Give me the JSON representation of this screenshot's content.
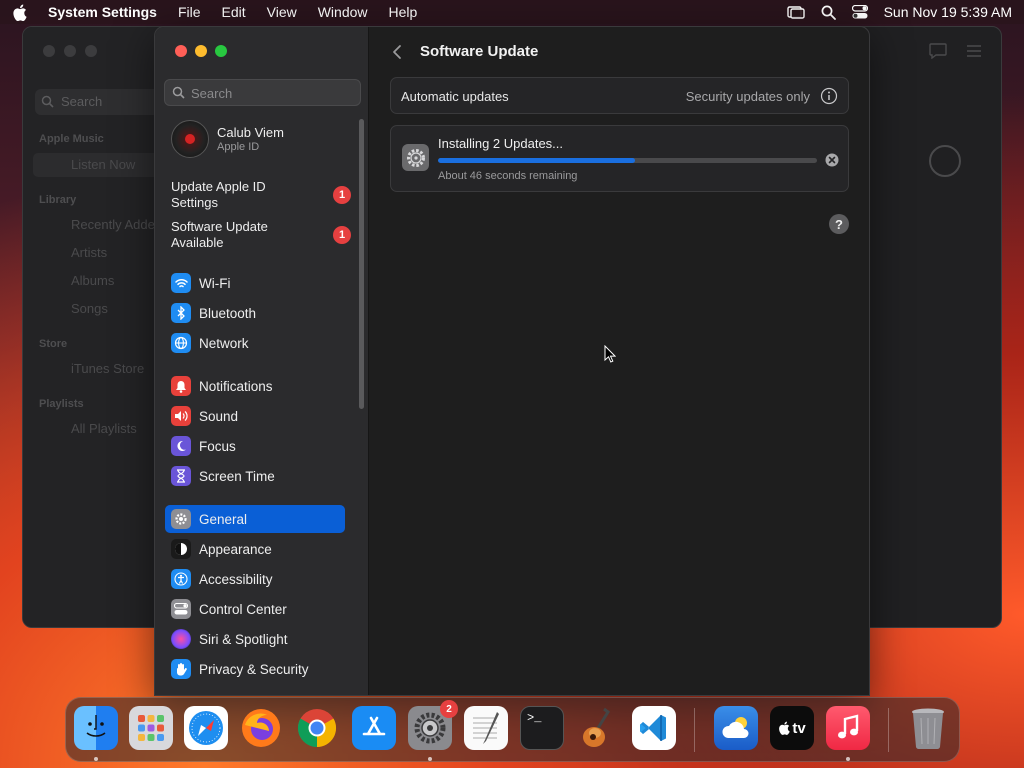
{
  "menubar": {
    "app_name": "System Settings",
    "items": [
      "File",
      "Edit",
      "View",
      "Window",
      "Help"
    ],
    "datetime": "Sun Nov 19  5:39 AM"
  },
  "music_window": {
    "search_placeholder": "Search",
    "sections": [
      {
        "title": "Apple Music",
        "items": [
          "Listen Now"
        ]
      },
      {
        "title": "Library",
        "items": [
          "Recently Added",
          "Artists",
          "Albums",
          "Songs"
        ]
      },
      {
        "title": "Store",
        "items": [
          "iTunes Store"
        ]
      },
      {
        "title": "Playlists",
        "items": [
          "All Playlists"
        ]
      }
    ]
  },
  "sidebar": {
    "search_placeholder": "Search",
    "user": {
      "name": "Calub Viem",
      "subtitle": "Apple ID"
    },
    "alerts": [
      {
        "label": "Update Apple ID Settings",
        "count": "1"
      },
      {
        "label": "Software Update Available",
        "count": "1"
      }
    ],
    "items": [
      {
        "label": "Wi-Fi",
        "icon": "wifi-icon",
        "color": "#1f8cf2"
      },
      {
        "label": "Bluetooth",
        "icon": "bluetooth-icon",
        "color": "#1f8cf2"
      },
      {
        "label": "Network",
        "icon": "globe-icon",
        "color": "#1f8cf2"
      },
      {
        "label": "Notifications",
        "icon": "bell-icon",
        "color": "#e8413b"
      },
      {
        "label": "Sound",
        "icon": "speaker-icon",
        "color": "#e8413b"
      },
      {
        "label": "Focus",
        "icon": "moon-icon",
        "color": "#6a55d8"
      },
      {
        "label": "Screen Time",
        "icon": "hourglass-icon",
        "color": "#6a55d8"
      },
      {
        "label": "General",
        "icon": "gear-icon",
        "color": "#8e8e93",
        "selected": true
      },
      {
        "label": "Appearance",
        "icon": "appearance-icon",
        "color": "#1a1a1a"
      },
      {
        "label": "Accessibility",
        "icon": "accessibility-icon",
        "color": "#1f8cf2"
      },
      {
        "label": "Control Center",
        "icon": "control-center-icon",
        "color": "#8e8e93"
      },
      {
        "label": "Siri & Spotlight",
        "icon": "siri-icon",
        "color": "#b14fd8"
      },
      {
        "label": "Privacy & Security",
        "icon": "hand-icon",
        "color": "#1f8cf2"
      }
    ]
  },
  "content": {
    "title": "Software Update",
    "auto_updates_label": "Automatic updates",
    "auto_updates_value": "Security updates only",
    "install_title": "Installing 2 Updates...",
    "install_progress": 0.52,
    "install_remaining": "About 46 seconds remaining",
    "help_label": "?"
  },
  "dock": {
    "apps": [
      {
        "name": "Finder",
        "icon": "finder-icon",
        "running": true
      },
      {
        "name": "Launchpad",
        "icon": "launchpad-icon",
        "running": false
      },
      {
        "name": "Safari",
        "icon": "safari-icon",
        "running": false
      },
      {
        "name": "Firefox",
        "icon": "firefox-icon",
        "running": false
      },
      {
        "name": "Chrome",
        "icon": "chrome-icon",
        "running": false
      },
      {
        "name": "App Store",
        "icon": "app-store-icon",
        "running": false
      },
      {
        "name": "System Settings",
        "icon": "settings-icon",
        "running": true,
        "badge": "2"
      },
      {
        "name": "TextEdit",
        "icon": "textedit-icon",
        "running": false
      },
      {
        "name": "Terminal",
        "icon": "terminal-icon",
        "running": false
      },
      {
        "name": "GarageBand",
        "icon": "garageband-icon",
        "running": false
      },
      {
        "name": "VS Code",
        "icon": "vscode-icon",
        "running": false
      },
      {
        "name": "Weather",
        "icon": "weather-icon",
        "running": false
      },
      {
        "name": "Apple TV",
        "icon": "appletv-icon",
        "running": false
      },
      {
        "name": "Music",
        "icon": "music-icon",
        "running": true
      },
      {
        "name": "Trash",
        "icon": "trash-icon",
        "running": false
      }
    ],
    "terminal_glyph": ">_",
    "tv_label": "tv"
  }
}
